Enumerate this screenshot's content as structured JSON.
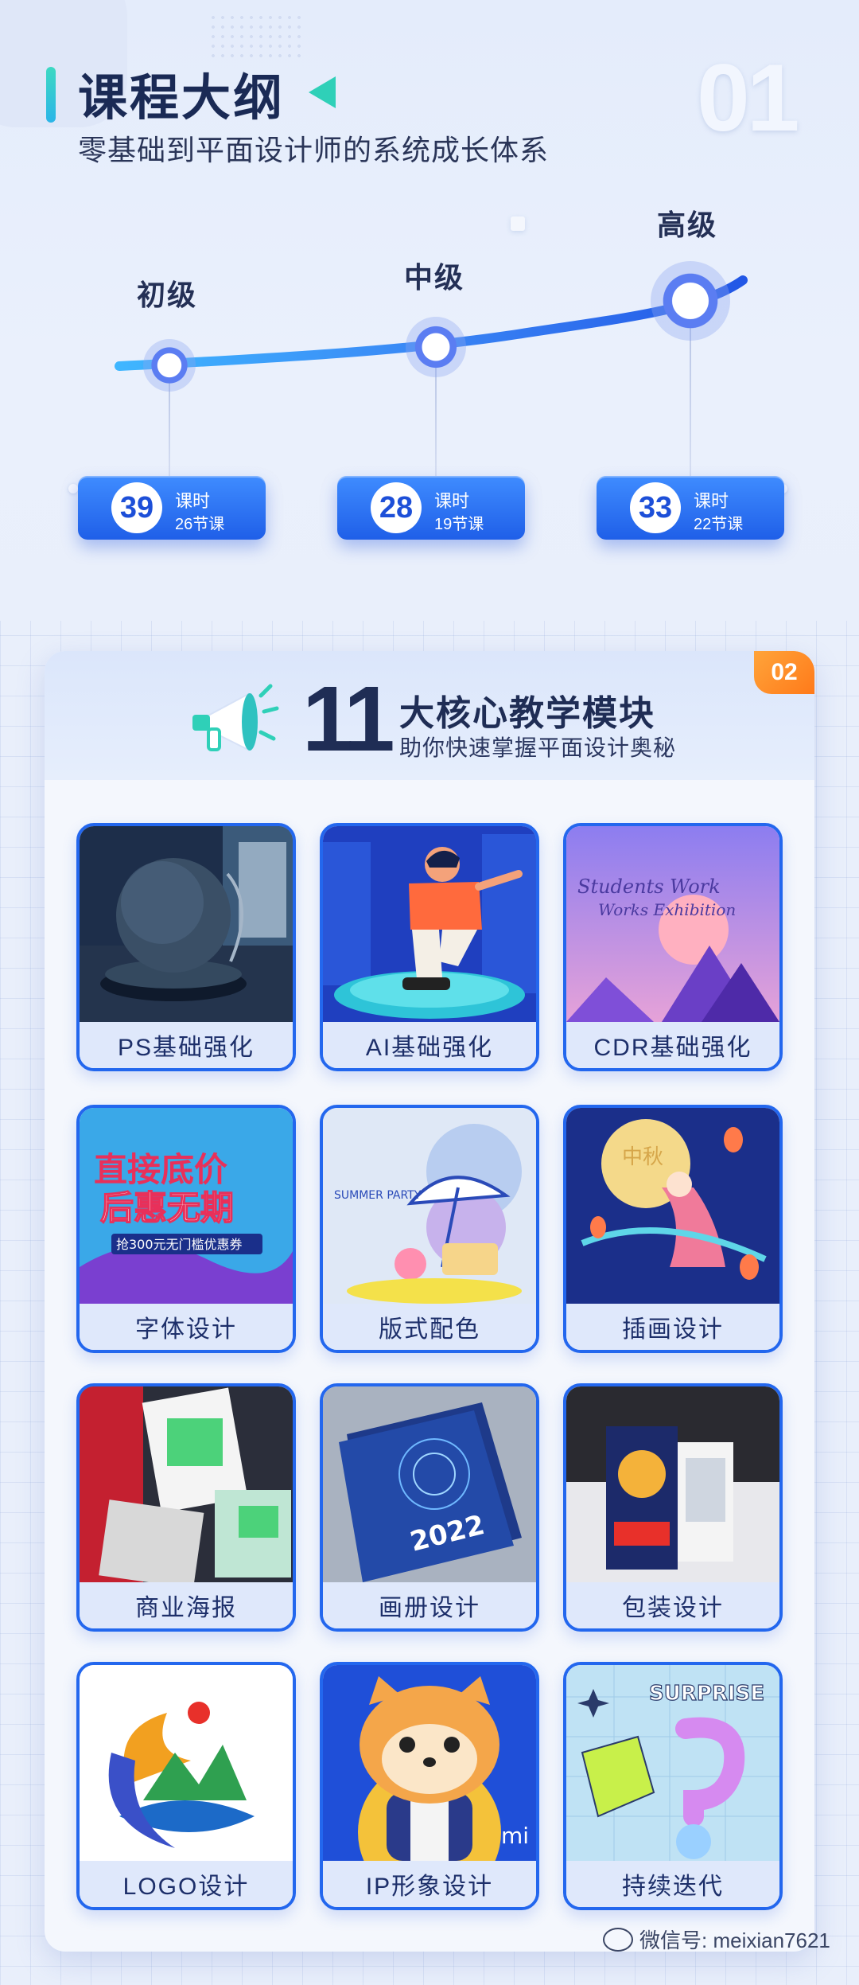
{
  "outline": {
    "title": "课程大纲",
    "subtitle": "零基础到平面设计师的系统成长体系",
    "section_number": "01",
    "levels": [
      {
        "label": "初级",
        "hours": "39",
        "hours_label": "课时",
        "lessons": "26节课"
      },
      {
        "label": "中级",
        "hours": "28",
        "hours_label": "课时",
        "lessons": "19节课"
      },
      {
        "label": "高级",
        "hours": "33",
        "hours_label": "课时",
        "lessons": "22节课"
      }
    ]
  },
  "modules": {
    "badge": "02",
    "count": "11",
    "title": "大核心教学模块",
    "subtitle": "助你快速掌握平面设计奥秘",
    "items": [
      {
        "label": "PS基础强化",
        "image": "speaker-render-image"
      },
      {
        "label": "AI基础强化",
        "image": "skater-illustration-image"
      },
      {
        "label": "CDR基础强化",
        "image": "exhibition-poster-image"
      },
      {
        "label": "字体设计",
        "image": "typography-poster-image"
      },
      {
        "label": "版式配色",
        "image": "summer-party-poster-image"
      },
      {
        "label": "插画设计",
        "image": "moon-goddess-illustration-image"
      },
      {
        "label": "商业海报",
        "image": "commercial-posters-image"
      },
      {
        "label": "画册设计",
        "image": "brochure-2022-image"
      },
      {
        "label": "包装设计",
        "image": "snack-packaging-image"
      },
      {
        "label": "LOGO设计",
        "image": "landscape-logo-image"
      },
      {
        "label": "IP形象设计",
        "image": "cat-mascot-image"
      },
      {
        "label": "持续迭代",
        "image": "surprise-3d-image"
      }
    ],
    "poster_texts": {
      "typo_line1": "直接底价",
      "typo_line2": "后惠无期",
      "typo_line3": "抢300元无门槛优惠券",
      "exhibition": "Students Work",
      "exhibition2": "Works Exhibition",
      "summer": "SUMMER PARTY",
      "brochure": "2022",
      "surprise": "SURPRISE",
      "mascot_mi": "mi",
      "moon_chars": "中秋"
    }
  },
  "watermark": {
    "text": "微信号: meixian7621"
  },
  "colors": {
    "accent": "#2367ee",
    "teal": "#2fd0b8",
    "orange": "#ff8a24",
    "navy": "#1f2d55"
  }
}
